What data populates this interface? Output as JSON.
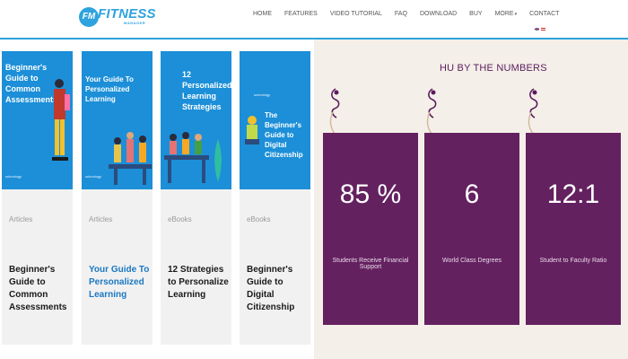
{
  "header": {
    "logo": {
      "badge": "FM",
      "word": "FITNESS",
      "sub": "MANAGER"
    },
    "nav": [
      "HOME",
      "FEATURES",
      "VIDEO TUTORIAL",
      "FAQ",
      "DOWNLOAD",
      "BUY",
      "MORE",
      "CONTACT"
    ],
    "more_caret": "▾"
  },
  "cards": [
    {
      "image_title": "Beginner's Guide to Common Assessments",
      "image_brand": "schoology",
      "category": "Articles",
      "title": "Beginner's Guide to Common Assessments",
      "title_color": "#1a1a1a"
    },
    {
      "image_title": "Your Guide To Personalized Learning",
      "image_brand": "schoology",
      "category": "Articles",
      "title": "Your Guide To Personalized Learning",
      "title_color": "#1a78c2"
    },
    {
      "image_title": "12 Personalized Learning Strategies",
      "image_brand": "",
      "category": "eBooks",
      "title": "12 Strategies to Personalize Learning",
      "title_color": "#1a1a1a"
    },
    {
      "image_title": "The Beginner's Guide to Digital Citizenship",
      "image_brand": "schoology",
      "category": "eBooks",
      "title": "Beginner's Guide to Digital Citizenship",
      "title_color": "#1a1a1a"
    }
  ],
  "numbers": {
    "title": "HU BY THE NUMBERS",
    "stats": [
      {
        "value": "85 %",
        "label": "Students Receive Financial Support"
      },
      {
        "value": "6",
        "label": "World Class Degrees"
      },
      {
        "value": "12:1",
        "label": "Student to Faculty Ratio"
      }
    ]
  },
  "colors": {
    "brand_blue": "#2ea3dd",
    "stat_purple": "#642160",
    "beige": "#f4efe8"
  }
}
